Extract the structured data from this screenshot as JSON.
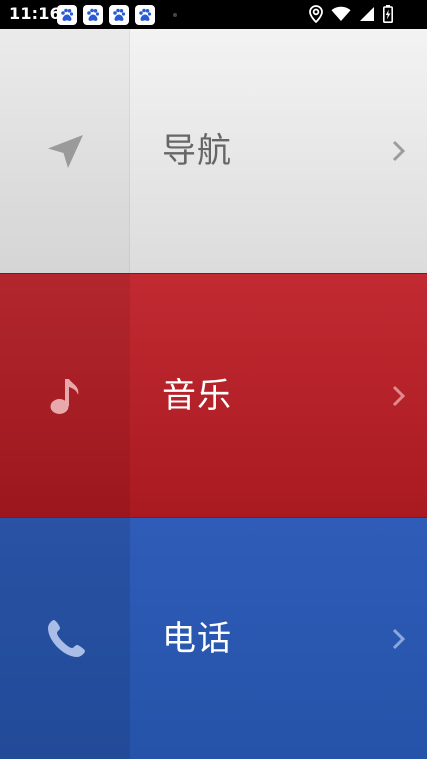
{
  "status_bar": {
    "time": "11:16",
    "notification_icons": [
      "baidu-paw-icon",
      "baidu-paw-icon",
      "baidu-paw-icon",
      "baidu-paw-icon"
    ],
    "right_icons": [
      "location-icon",
      "wifi-icon",
      "signal-icon",
      "battery-charging-icon"
    ]
  },
  "menu": {
    "items": [
      {
        "label": "导航",
        "icon": "navigation-arrow-icon",
        "background": "#e6e6e6",
        "text_color": "#666666"
      },
      {
        "label": "音乐",
        "icon": "music-note-icon",
        "background": "#b9252c",
        "text_color": "#ffffff"
      },
      {
        "label": "电话",
        "icon": "phone-handset-icon",
        "background": "#2b58b1",
        "text_color": "#ffffff"
      }
    ]
  }
}
